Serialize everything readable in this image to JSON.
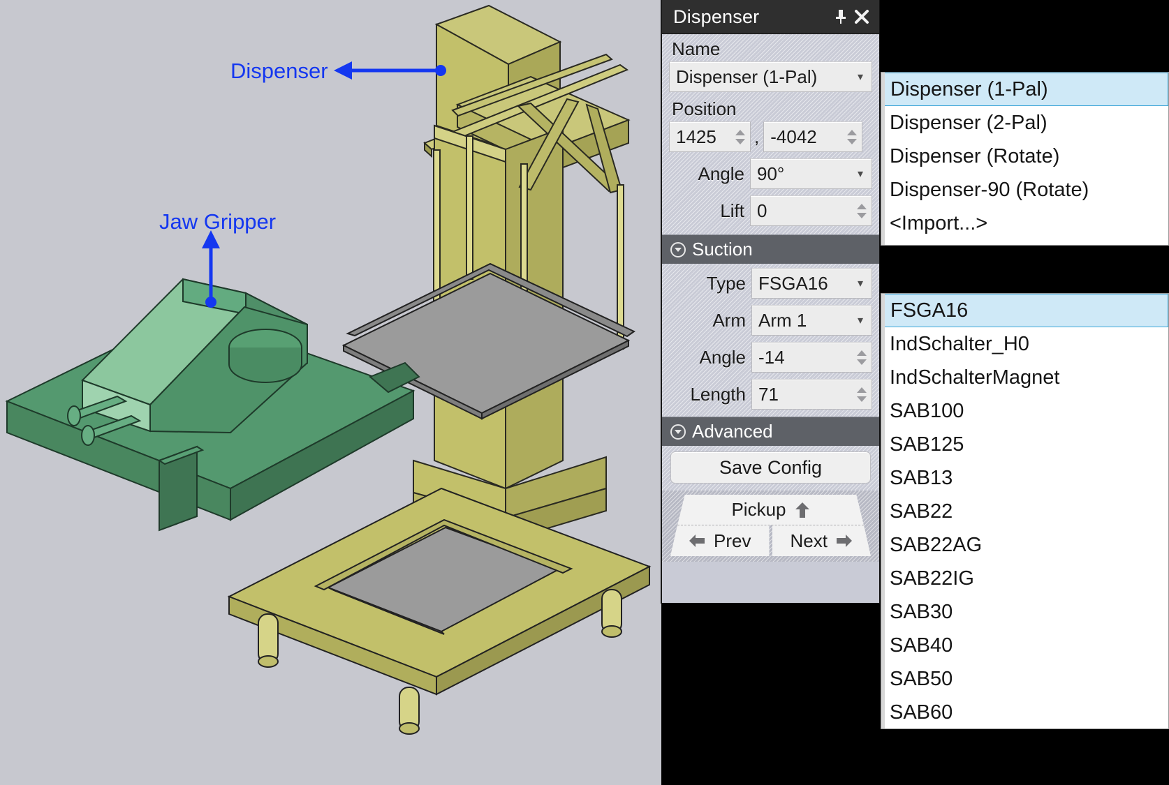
{
  "viewport": {
    "background_color": "#c7c8cf",
    "annotations": [
      {
        "label": "Dispenser",
        "color": "#1437f0"
      },
      {
        "label": "Jaw Gripper",
        "color": "#1437f0"
      }
    ],
    "model_colors": {
      "dispenser_yellow": "#c2c06a",
      "gripper_green": "#4d9170",
      "plate_gray": "#9b9b9b"
    }
  },
  "panel": {
    "title": "Dispenser",
    "pin_icon": "pin-icon",
    "close_icon": "close-icon",
    "name": {
      "label": "Name",
      "value": "Dispenser (1-Pal)"
    },
    "position": {
      "label": "Position",
      "x_value": "1425",
      "separator": ",",
      "y_value": "-4042"
    },
    "angle": {
      "label": "Angle",
      "value": "90°"
    },
    "lift": {
      "label": "Lift",
      "value": "0"
    },
    "suction": {
      "header": "Suction",
      "type": {
        "label": "Type",
        "value": "FSGA16"
      },
      "arm": {
        "label": "Arm",
        "value": "Arm 1"
      },
      "angle": {
        "label": "Angle",
        "value": "-14"
      },
      "length": {
        "label": "Length",
        "value": "71"
      }
    },
    "advanced": {
      "header": "Advanced",
      "save_config": "Save Config",
      "pickup": "Pickup",
      "prev": "Prev",
      "next": "Next"
    }
  },
  "name_dropdown": {
    "items": [
      "Dispenser (1-Pal)",
      "Dispenser (2-Pal)",
      "Dispenser (Rotate)",
      "Dispenser-90 (Rotate)",
      "<Import...>"
    ],
    "selected_index": 0,
    "selected_bg": "#cfe9f7"
  },
  "type_dropdown": {
    "items": [
      "FSGA16",
      "IndSchalter_H0",
      "IndSchalterMagnet",
      "SAB100",
      "SAB125",
      "SAB13",
      "SAB22",
      "SAB22AG",
      "SAB22IG",
      "SAB30",
      "SAB40",
      "SAB50",
      "SAB60"
    ],
    "selected_index": 0,
    "selected_bg": "#cfe9f7"
  }
}
